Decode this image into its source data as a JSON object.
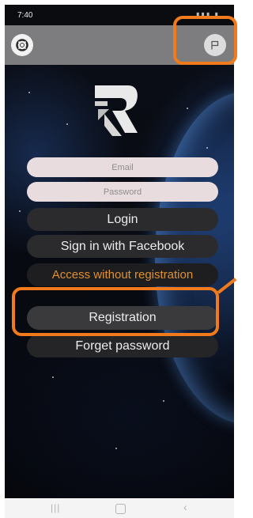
{
  "status_bar": {
    "time": "7:40"
  },
  "header": {
    "support_icon": "lifebuoy-icon",
    "flag_icon": "flag-icon"
  },
  "login_form": {
    "email_placeholder": "Email",
    "password_placeholder": "Password",
    "login_label": "Login",
    "facebook_label": "Sign in with Facebook",
    "guest_label": "Access without registration",
    "registration_label": "Registration",
    "forget_password_label": "Forget password"
  },
  "colors": {
    "accent_orange": "#f07a1c",
    "guest_text": "#e0912e",
    "field_bg": "#e9dcdf",
    "button_bg": "#2b2b2d"
  },
  "nav_bar": {
    "recent_icon": "recent-apps-icon",
    "home_icon": "home-icon",
    "back_icon": "back-icon"
  }
}
